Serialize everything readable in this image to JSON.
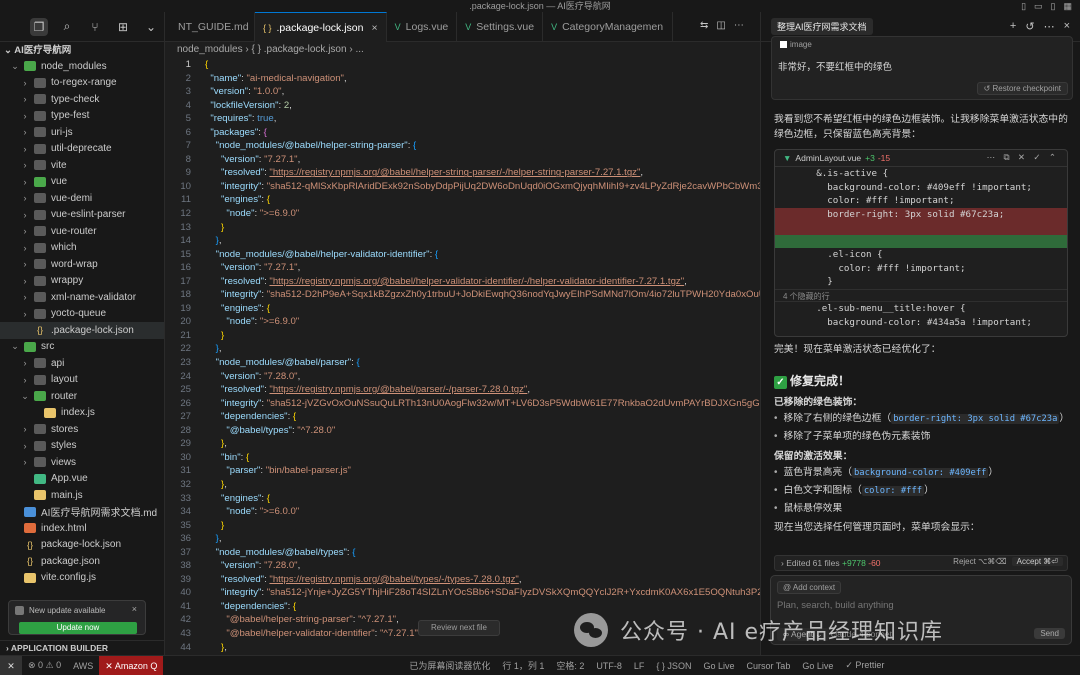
{
  "window": {
    "title": ".package-lock.json — AI医疗导航网"
  },
  "sidebar": {
    "root": "AI医疗导航网",
    "items": [
      {
        "label": "node_modules",
        "depth": 0,
        "kind": "folder-green",
        "chev": "⌄"
      },
      {
        "label": "to-regex-range",
        "depth": 1,
        "kind": "folder",
        "chev": "›"
      },
      {
        "label": "type-check",
        "depth": 1,
        "kind": "folder",
        "chev": "›"
      },
      {
        "label": "type-fest",
        "depth": 1,
        "kind": "folder",
        "chev": "›"
      },
      {
        "label": "uri-js",
        "depth": 1,
        "kind": "folder",
        "chev": "›"
      },
      {
        "label": "util-deprecate",
        "depth": 1,
        "kind": "folder",
        "chev": "›"
      },
      {
        "label": "vite",
        "depth": 1,
        "kind": "folder",
        "chev": "›"
      },
      {
        "label": "vue",
        "depth": 1,
        "kind": "folder-green",
        "chev": "›"
      },
      {
        "label": "vue-demi",
        "depth": 1,
        "kind": "folder",
        "chev": "›"
      },
      {
        "label": "vue-eslint-parser",
        "depth": 1,
        "kind": "folder",
        "chev": "›"
      },
      {
        "label": "vue-router",
        "depth": 1,
        "kind": "folder",
        "chev": "›"
      },
      {
        "label": "which",
        "depth": 1,
        "kind": "folder",
        "chev": "›"
      },
      {
        "label": "word-wrap",
        "depth": 1,
        "kind": "folder",
        "chev": "›"
      },
      {
        "label": "wrappy",
        "depth": 1,
        "kind": "folder",
        "chev": "›"
      },
      {
        "label": "xml-name-validator",
        "depth": 1,
        "kind": "folder",
        "chev": "›"
      },
      {
        "label": "yocto-queue",
        "depth": 1,
        "kind": "folder",
        "chev": "›"
      },
      {
        "label": ".package-lock.json",
        "depth": 1,
        "kind": "json",
        "chev": "",
        "selected": true
      },
      {
        "label": "src",
        "depth": 0,
        "kind": "folder-green",
        "chev": "⌄"
      },
      {
        "label": "api",
        "depth": 1,
        "kind": "folder",
        "chev": "›"
      },
      {
        "label": "layout",
        "depth": 1,
        "kind": "folder",
        "chev": "›"
      },
      {
        "label": "router",
        "depth": 1,
        "kind": "folder-green",
        "chev": "⌄"
      },
      {
        "label": "index.js",
        "depth": 2,
        "kind": "js",
        "chev": ""
      },
      {
        "label": "stores",
        "depth": 1,
        "kind": "folder",
        "chev": "›"
      },
      {
        "label": "styles",
        "depth": 1,
        "kind": "folder",
        "chev": "›"
      },
      {
        "label": "views",
        "depth": 1,
        "kind": "folder",
        "chev": "›"
      },
      {
        "label": "App.vue",
        "depth": 1,
        "kind": "vue",
        "chev": ""
      },
      {
        "label": "main.js",
        "depth": 1,
        "kind": "js",
        "chev": ""
      },
      {
        "label": "AI医疗导航网需求文档.md",
        "depth": 0,
        "kind": "md",
        "chev": ""
      },
      {
        "label": "index.html",
        "depth": 0,
        "kind": "html",
        "chev": ""
      },
      {
        "label": "package-lock.json",
        "depth": 0,
        "kind": "json",
        "chev": ""
      },
      {
        "label": "package.json",
        "depth": 0,
        "kind": "json",
        "chev": ""
      },
      {
        "label": "vite.config.js",
        "depth": 0,
        "kind": "js",
        "chev": ""
      }
    ],
    "update": {
      "text": "New update available",
      "button": "Update now"
    },
    "app_builder": "APPLICATION BUILDER"
  },
  "tabs": [
    {
      "label": "NT_GUIDE.md",
      "icon": "",
      "active": false
    },
    {
      "label": ".package-lock.json",
      "icon": "{ }",
      "active": true
    },
    {
      "label": "Logs.vue",
      "icon": "V",
      "active": false
    },
    {
      "label": "Settings.vue",
      "icon": "V",
      "active": false
    },
    {
      "label": "CategoryManagemen",
      "icon": "V",
      "active": false
    }
  ],
  "breadcrumb": "node_modules  ›  { }  .package-lock.json  ›  ...",
  "editor": {
    "current_line": 1,
    "review_next": "Review next file"
  },
  "chat": {
    "title": "整理AI医疗网需求文档",
    "image_chip": "image",
    "user_message": "非常好，不要红框中的绿色",
    "restore_button": "Restore checkpoint",
    "reply_intro": "我看到您不希望红框中的绿色边框装饰。让我移除菜单激活状态中的绿色边框，只保留蓝色高亮背景：",
    "diff": {
      "file": "AdminLayout.vue",
      "added": "+3",
      "removed": "-15",
      "lines": [
        {
          "text": "      &.is-active {",
          "type": ""
        },
        {
          "text": "        background-color: #409eff !important;",
          "type": ""
        },
        {
          "text": "        color: #fff !important;",
          "type": ""
        },
        {
          "text": "        border-right: 3px solid #67c23a;",
          "type": "del"
        },
        {
          "text": "",
          "type": "del"
        },
        {
          "text": "",
          "type": "add"
        },
        {
          "text": "        .el-icon {",
          "type": ""
        },
        {
          "text": "          color: #fff !important;",
          "type": ""
        },
        {
          "text": "        }",
          "type": ""
        },
        {
          "text": "4 个隐藏的行",
          "type": "fold"
        },
        {
          "text": "      .el-sub-menu__title:hover {",
          "type": ""
        },
        {
          "text": "        background-color: #434a5a !important;",
          "type": ""
        }
      ]
    },
    "done_text": "完美！现在菜单激活状态已经优化了：",
    "fix_title": "修复完成！",
    "removed_heading": "已移除的绿色装饰：",
    "removed_items": [
      {
        "text": "移除了右侧的绿色边框（",
        "code": "border-right: 3px solid #67c23a",
        "tail": "）"
      },
      {
        "text": "移除了子菜单项的绿色伪元素装饰",
        "code": "",
        "tail": ""
      }
    ],
    "kept_heading": "保留的激活效果：",
    "kept_items": [
      {
        "text": "蓝色背景高亮（",
        "code": "background-color: #409eff",
        "tail": "）"
      },
      {
        "text": "白色文字和图标（",
        "code": "color: #fff",
        "tail": "）"
      },
      {
        "text": "鼠标悬停效果",
        "code": "",
        "tail": ""
      }
    ],
    "closing": "现在当您选择任何管理页面时，菜单项会显示：",
    "edited": {
      "label": "Edited 61 files",
      "plus": "+9778",
      "minus": "-60",
      "reject": "Reject ⌥⌘⌫",
      "accept": "Accept ⌘⏎"
    },
    "composer": {
      "context": "Add context",
      "placeholder": "Plan, search, build anything",
      "agent": "Agent",
      "model": "claude-4-sonnet",
      "send": "Send"
    }
  },
  "statusbar": {
    "errors": "⊗ 0  ⚠ 0",
    "aws": "AWS",
    "amazon": "✕ Amazon Q",
    "screen_reader": "已为屏幕阅读器优化",
    "position": "行 1，列 1",
    "spaces": "空格: 2",
    "encoding": "UTF-8",
    "eol": "LF",
    "lang": "{ } JSON",
    "golive1": "Go Live",
    "cursor_tab": "Cursor Tab",
    "golive2": "Go Live",
    "prettier": "✓ Prettier"
  },
  "watermark": "公众号 · AI e疗产品经理知识库"
}
